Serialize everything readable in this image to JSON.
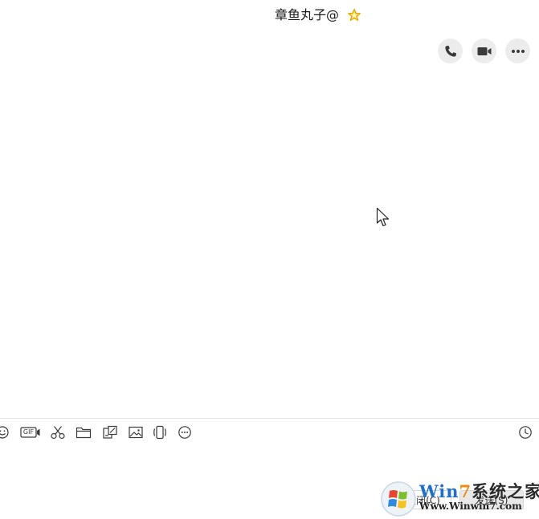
{
  "header": {
    "title": "章鱼丸子@",
    "star_color": "#f0c419"
  },
  "call_actions": [
    {
      "icon": "phone-icon",
      "label": "语音通话"
    },
    {
      "icon": "video-icon",
      "label": "视频通话"
    },
    {
      "icon": "more-icon",
      "label": "更多"
    }
  ],
  "toolbar": {
    "gif_label": "GIF",
    "items": [
      "emoji-icon",
      "gif-icon",
      "scissors-icon",
      "folder-icon",
      "screenshot-icon",
      "image-icon",
      "shake-icon",
      "more-circle-icon",
      "history-clock-icon"
    ]
  },
  "buttons": {
    "close_label": "关闭(C)",
    "send_label": "发送(S)"
  },
  "watermark": {
    "title_part1": "Win",
    "title_part2": "7",
    "title_part3": "系统之家",
    "url": "Www.Winwin7.com"
  },
  "colors": {
    "divider": "#e6e6e6",
    "button_bg": "#ececec",
    "icon": "#3a3a3a",
    "watermark_blue": "#1f6fd0",
    "watermark_orange": "#f08a12"
  }
}
